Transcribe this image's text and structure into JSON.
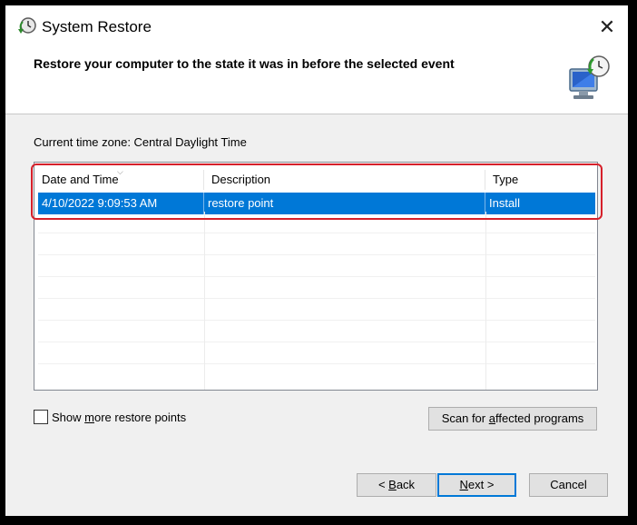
{
  "window": {
    "title": "System Restore",
    "close_glyph": "✕"
  },
  "header": {
    "heading": "Restore your computer to the state it was in before the selected event"
  },
  "timezone_label": "Current time zone: Central Daylight Time",
  "list": {
    "columns": [
      "Date and Time",
      "Description",
      "Type"
    ],
    "sort_indicator": "⌵",
    "rows": [
      {
        "date": "4/10/2022 9:09:53 AM",
        "description": "restore point",
        "type": "Install",
        "selected": true
      }
    ]
  },
  "options": {
    "show_more_pre": "Show ",
    "show_more_mnemonic": "m",
    "show_more_post": "ore restore points",
    "show_more_checked": false
  },
  "buttons": {
    "scan_pre": "Scan for ",
    "scan_mnemonic": "a",
    "scan_post": "ffected programs",
    "back_pre": "< ",
    "back_mnemonic": "B",
    "back_post": "ack",
    "next_mnemonic": "N",
    "next_post": "ext >",
    "cancel": "Cancel"
  },
  "colors": {
    "selection": "#0078d7",
    "highlight_border": "#d6202a",
    "dialog_bg": "#f0f0f0"
  },
  "icons": {
    "title": "system-restore-icon",
    "header": "restore-computer-icon",
    "close": "close-icon"
  }
}
